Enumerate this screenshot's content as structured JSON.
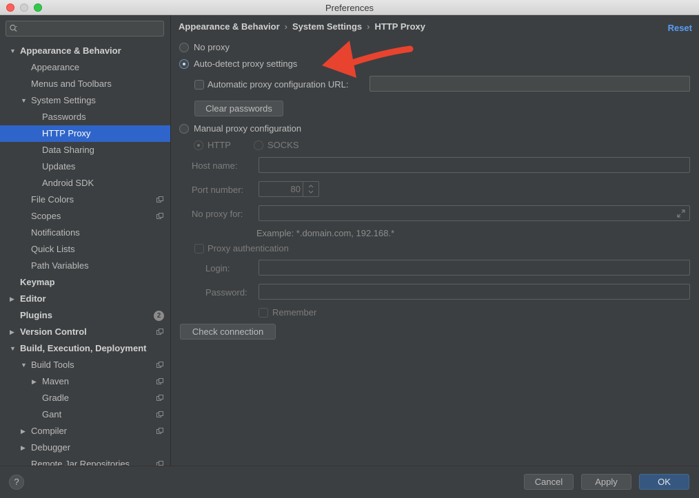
{
  "window": {
    "title": "Preferences"
  },
  "search": {
    "placeholder": ""
  },
  "sidebar": {
    "items": [
      {
        "label": "Appearance & Behavior",
        "level": 0,
        "bold": true,
        "arrow": "down"
      },
      {
        "label": "Appearance",
        "level": 1
      },
      {
        "label": "Menus and Toolbars",
        "level": 1
      },
      {
        "label": "System Settings",
        "level": 1,
        "arrow": "down"
      },
      {
        "label": "Passwords",
        "level": 2
      },
      {
        "label": "HTTP Proxy",
        "level": 2,
        "selected": true
      },
      {
        "label": "Data Sharing",
        "level": 2
      },
      {
        "label": "Updates",
        "level": 2
      },
      {
        "label": "Android SDK",
        "level": 2
      },
      {
        "label": "File Colors",
        "level": 1,
        "copy_icon": true
      },
      {
        "label": "Scopes",
        "level": 1,
        "copy_icon": true
      },
      {
        "label": "Notifications",
        "level": 1
      },
      {
        "label": "Quick Lists",
        "level": 1
      },
      {
        "label": "Path Variables",
        "level": 1
      },
      {
        "label": "Keymap",
        "level": 0,
        "bold": true
      },
      {
        "label": "Editor",
        "level": 0,
        "bold": true,
        "arrow": "right"
      },
      {
        "label": "Plugins",
        "level": 0,
        "bold": true,
        "badge": "2"
      },
      {
        "label": "Version Control",
        "level": 0,
        "bold": true,
        "arrow": "right",
        "copy_icon": true
      },
      {
        "label": "Build, Execution, Deployment",
        "level": 0,
        "bold": true,
        "arrow": "down"
      },
      {
        "label": "Build Tools",
        "level": 1,
        "arrow": "down",
        "copy_icon": true
      },
      {
        "label": "Maven",
        "level": 2,
        "arrow": "right",
        "copy_icon": true
      },
      {
        "label": "Gradle",
        "level": 2,
        "copy_icon": true
      },
      {
        "label": "Gant",
        "level": 2,
        "copy_icon": true
      },
      {
        "label": "Compiler",
        "level": 1,
        "arrow": "right",
        "copy_icon": true
      },
      {
        "label": "Debugger",
        "level": 1,
        "arrow": "right"
      },
      {
        "label": "Remote Jar Repositories",
        "level": 1,
        "copy_icon": true
      }
    ]
  },
  "breadcrumb": [
    "Appearance & Behavior",
    "System Settings",
    "HTTP Proxy"
  ],
  "breadcrumb_sep": "›",
  "reset_label": "Reset",
  "proxy": {
    "no_proxy": "No proxy",
    "auto_detect": "Auto-detect proxy settings",
    "auto_config_url_label": "Automatic proxy configuration URL:",
    "auto_config_url_value": "",
    "clear_passwords": "Clear passwords",
    "manual": "Manual proxy configuration",
    "http": "HTTP",
    "socks": "SOCKS",
    "host_label": "Host name:",
    "host_value": "",
    "port_label": "Port number:",
    "port_value": "80",
    "no_proxy_for_label": "No proxy for:",
    "no_proxy_for_value": "",
    "example": "Example: *.domain.com, 192.168.*",
    "proxy_auth": "Proxy authentication",
    "login_label": "Login:",
    "login_value": "",
    "password_label": "Password:",
    "password_value": "",
    "remember": "Remember",
    "check_connection": "Check connection",
    "selected_mode": "auto_detect"
  },
  "footer": {
    "help": "?",
    "cancel": "Cancel",
    "apply": "Apply",
    "ok": "OK"
  },
  "colors": {
    "background": "#3c3f41",
    "selection": "#2f65ca",
    "link": "#589df6",
    "annotation_arrow": "#e8432f",
    "ok_button": "#365880"
  }
}
